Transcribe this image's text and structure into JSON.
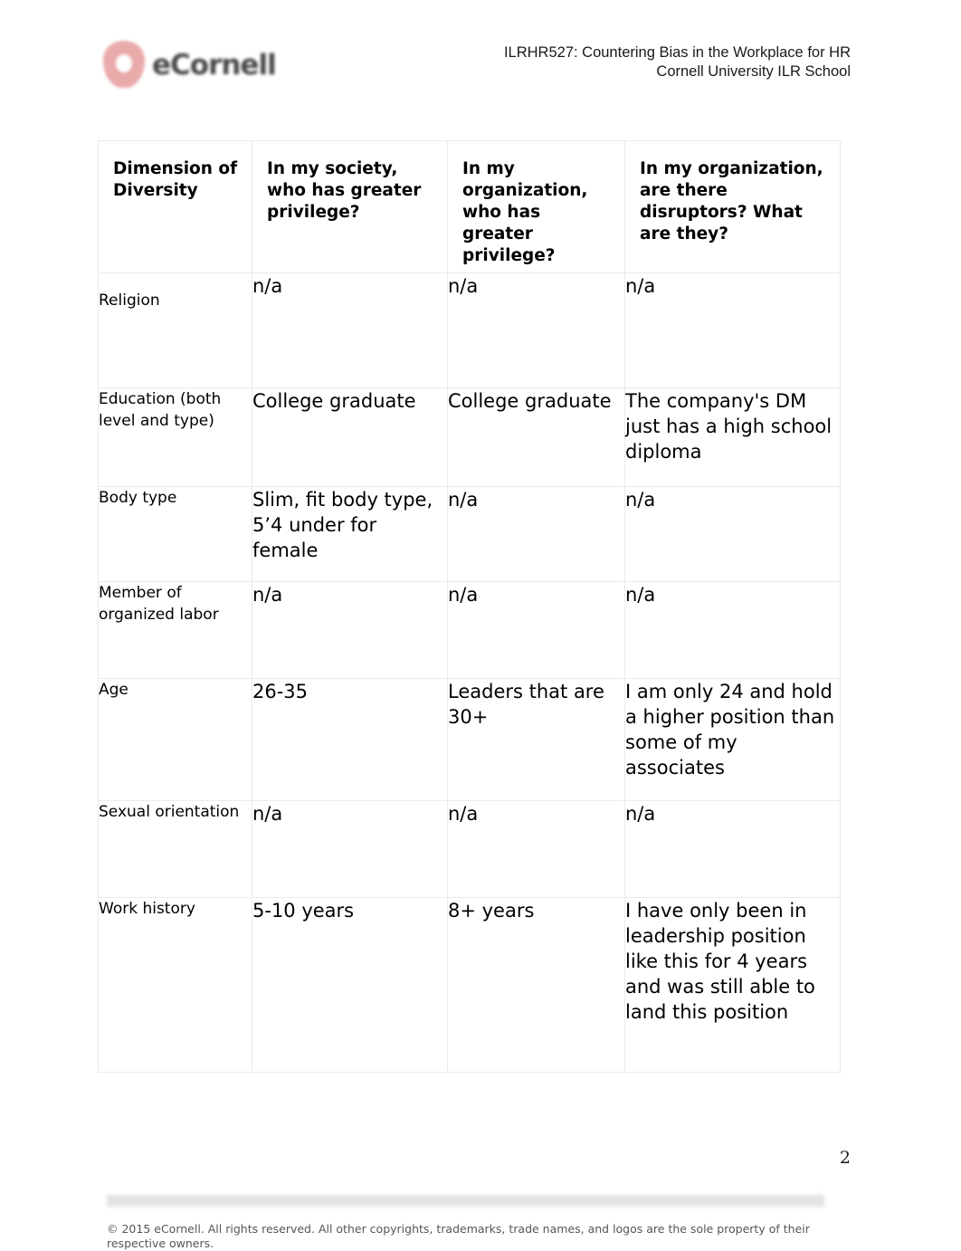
{
  "document": {
    "page_number": "2"
  },
  "header": {
    "logo_text": "eCornell",
    "logo_icon": "ecornell-shield-logo",
    "course_line": "ILRHR527: Countering Bias in the Workplace for HR",
    "school_line": "Cornell University ILR School"
  },
  "table": {
    "columns": [
      "Dimension of Diversity",
      "In my society, who has greater privilege?",
      "In my organization, who has greater privilege?",
      "In my organization, are there disruptors? What are they?"
    ],
    "rows": [
      {
        "dimension": "Religion",
        "society_privilege": "n/a",
        "org_privilege": "n/a",
        "disruptors": "n/a"
      },
      {
        "dimension": "Education (both level and type)",
        "society_privilege": "College graduate",
        "org_privilege": "College graduate",
        "disruptors": "The company's DM just has a high school diploma"
      },
      {
        "dimension": "Body type",
        "society_privilege": "Slim, fit body type, 5’4 under for female",
        "org_privilege": "n/a",
        "disruptors": "n/a"
      },
      {
        "dimension": "Member of organized labor",
        "society_privilege": "n/a",
        "org_privilege": "n/a",
        "disruptors": "n/a"
      },
      {
        "dimension": "Age",
        "society_privilege": "26-35",
        "org_privilege": "Leaders that are 30+",
        "disruptors": "I am only 24 and hold a higher position than some of my associates"
      },
      {
        "dimension": "Sexual orientation",
        "society_privilege": "n/a",
        "org_privilege": "n/a",
        "disruptors": "n/a"
      },
      {
        "dimension": "Work history",
        "society_privilege": "5-10 years",
        "org_privilege": "8+ years",
        "disruptors": "I have only been in leadership position like this for 4 years and was still able to land this position"
      }
    ]
  },
  "footer": {
    "copyright": "© 2015 eCornell. All rights reserved. All other copyrights, trademarks, trade names, and logos are the sole property of their respective owners."
  },
  "colors": {
    "logo_red": "#e8a3a3",
    "table_border": "#eceaea",
    "footer_bar": "#e3e3e3",
    "footer_text": "#565656"
  }
}
